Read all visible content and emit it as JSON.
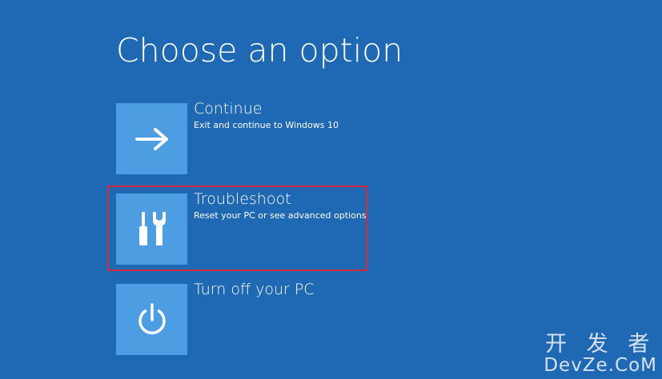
{
  "screen": {
    "title": "Choose an option",
    "background_color": "#1f68b4",
    "tile_color": "#4d9de3",
    "highlight_color": "#d8293b"
  },
  "options": [
    {
      "icon": "arrow-right-icon",
      "title": "Continue",
      "description": "Exit and continue to Windows 10"
    },
    {
      "icon": "tools-icon",
      "title": "Troubleshoot",
      "description": "Reset your PC or see advanced options",
      "highlighted": true
    },
    {
      "icon": "power-icon",
      "title": "Turn off your PC",
      "description": ""
    }
  ],
  "watermark": {
    "line1": "开 发 者",
    "line2": "DevZe.CoM"
  }
}
